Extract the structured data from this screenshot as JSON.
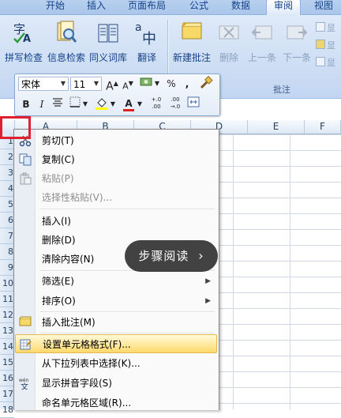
{
  "ribbon_tabs": [
    "开始",
    "插入",
    "页面布局",
    "公式",
    "数据",
    "审阅",
    "视图"
  ],
  "active_tab": "审阅",
  "proofing_buttons": [
    {
      "label": "拼写检查",
      "icon": "spell-check-icon"
    },
    {
      "label": "信息检索",
      "icon": "research-icon"
    },
    {
      "label": "同义词库",
      "icon": "thesaurus-icon"
    },
    {
      "label": "翻译",
      "icon": "translate-icon"
    }
  ],
  "comment_buttons": [
    {
      "label": "新建批注",
      "icon": "new-comment-icon",
      "enabled": true
    },
    {
      "label": "删除",
      "icon": "delete-comment-icon",
      "enabled": false
    },
    {
      "label": "上一条",
      "icon": "previous-comment-icon",
      "enabled": false
    },
    {
      "label": "下一条",
      "icon": "next-comment-icon",
      "enabled": false
    }
  ],
  "comment_small_buttons": [
    "显",
    "显",
    "显"
  ],
  "comment_group_label": "批注",
  "mini_toolbar": {
    "font_name": "宋体",
    "font_size": "11",
    "grow_font": "A",
    "shrink_font": "A",
    "percent": "%",
    "comma": ",",
    "bold": "B",
    "italic": "I",
    "font_color_letter": "A",
    "increase_decimal": "+.0 .00",
    "decrease_decimal": ".00 →.0"
  },
  "column_headers": [
    "A",
    "B",
    "C",
    "D",
    "E",
    "F"
  ],
  "row_numbers": [
    "1",
    "2",
    "3",
    "4",
    "5",
    "6",
    "7",
    "8",
    "9",
    "10",
    "11",
    "12",
    "13",
    "14",
    "15",
    "16",
    "17",
    "18"
  ],
  "context_menu": [
    {
      "label": "剪切(T)",
      "icon": "cut-icon",
      "enabled": true
    },
    {
      "label": "复制(C)",
      "icon": "copy-icon",
      "enabled": true
    },
    {
      "label": "粘贴(P)",
      "icon": "paste-icon",
      "enabled": false
    },
    {
      "label": "选择性粘贴(V)...",
      "enabled": false
    },
    {
      "label": "插入(I)",
      "enabled": true
    },
    {
      "label": "删除(D)",
      "enabled": true
    },
    {
      "label": "清除内容(N)",
      "enabled": true
    },
    {
      "label": "筛选(E)",
      "enabled": true,
      "submenu": true
    },
    {
      "label": "排序(O)",
      "enabled": true,
      "submenu": true
    },
    {
      "label": "插入批注(M)",
      "icon": "insert-comment-icon",
      "enabled": true
    },
    {
      "label": "设置单元格格式(F)...",
      "icon": "format-cells-icon",
      "enabled": true,
      "highlighted": true
    },
    {
      "label": "从下拉列表中选择(K)...",
      "enabled": true
    },
    {
      "label": "显示拼音字段(S)",
      "icon": "phonetic-icon",
      "enabled": true
    },
    {
      "label": "命名单元格区域(R)...",
      "enabled": true
    }
  ],
  "overlay": {
    "label": "步骤阅读",
    "chevron": "›"
  },
  "colors": {
    "highlight": "#ffe9a0",
    "ribbon": "#cbdcf3",
    "marker": "#e02030"
  }
}
